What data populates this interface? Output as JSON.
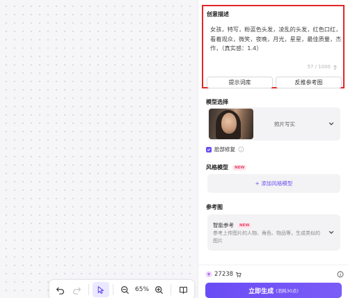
{
  "canvas": {
    "toolbar": {
      "zoom_label": "65%",
      "icons": [
        "undo-icon",
        "redo-icon",
        "pointer-icon",
        "zoom-out-icon",
        "zoom-in-icon",
        "book-icon"
      ]
    }
  },
  "panel": {
    "prompt": {
      "title": "创意描述",
      "text": "女孩，特写，粉蓝色头发，凌乱的头发，红色口红，看着观众，微笑，夜晚，月光，星星，最佳质量，杰作，（真实感：1.4）",
      "char_count": "57 / 1000",
      "btn_prompt_library": "提示词库",
      "btn_reverse_image": "反推参考图"
    },
    "model": {
      "title": "模型选择",
      "name": "照片写实"
    },
    "face_repair": {
      "label": "脸部修复",
      "checked": true
    },
    "style_model": {
      "title": "风格模型",
      "badge": "NEW",
      "add_label": "+ 添加风格模型"
    },
    "reference": {
      "title": "参考图",
      "smart_label": "智能参考",
      "badge": "NEW",
      "description": "参考上传图片的人物、角色、物品等，生成类似的图片"
    },
    "bottom": {
      "credits": "27238",
      "generate_label": "立即生成",
      "generate_cost": "(消耗30点)"
    }
  },
  "colors": {
    "accent": "#6b4ef0",
    "highlight_border": "#e12626",
    "badge_text": "#e8456b"
  }
}
